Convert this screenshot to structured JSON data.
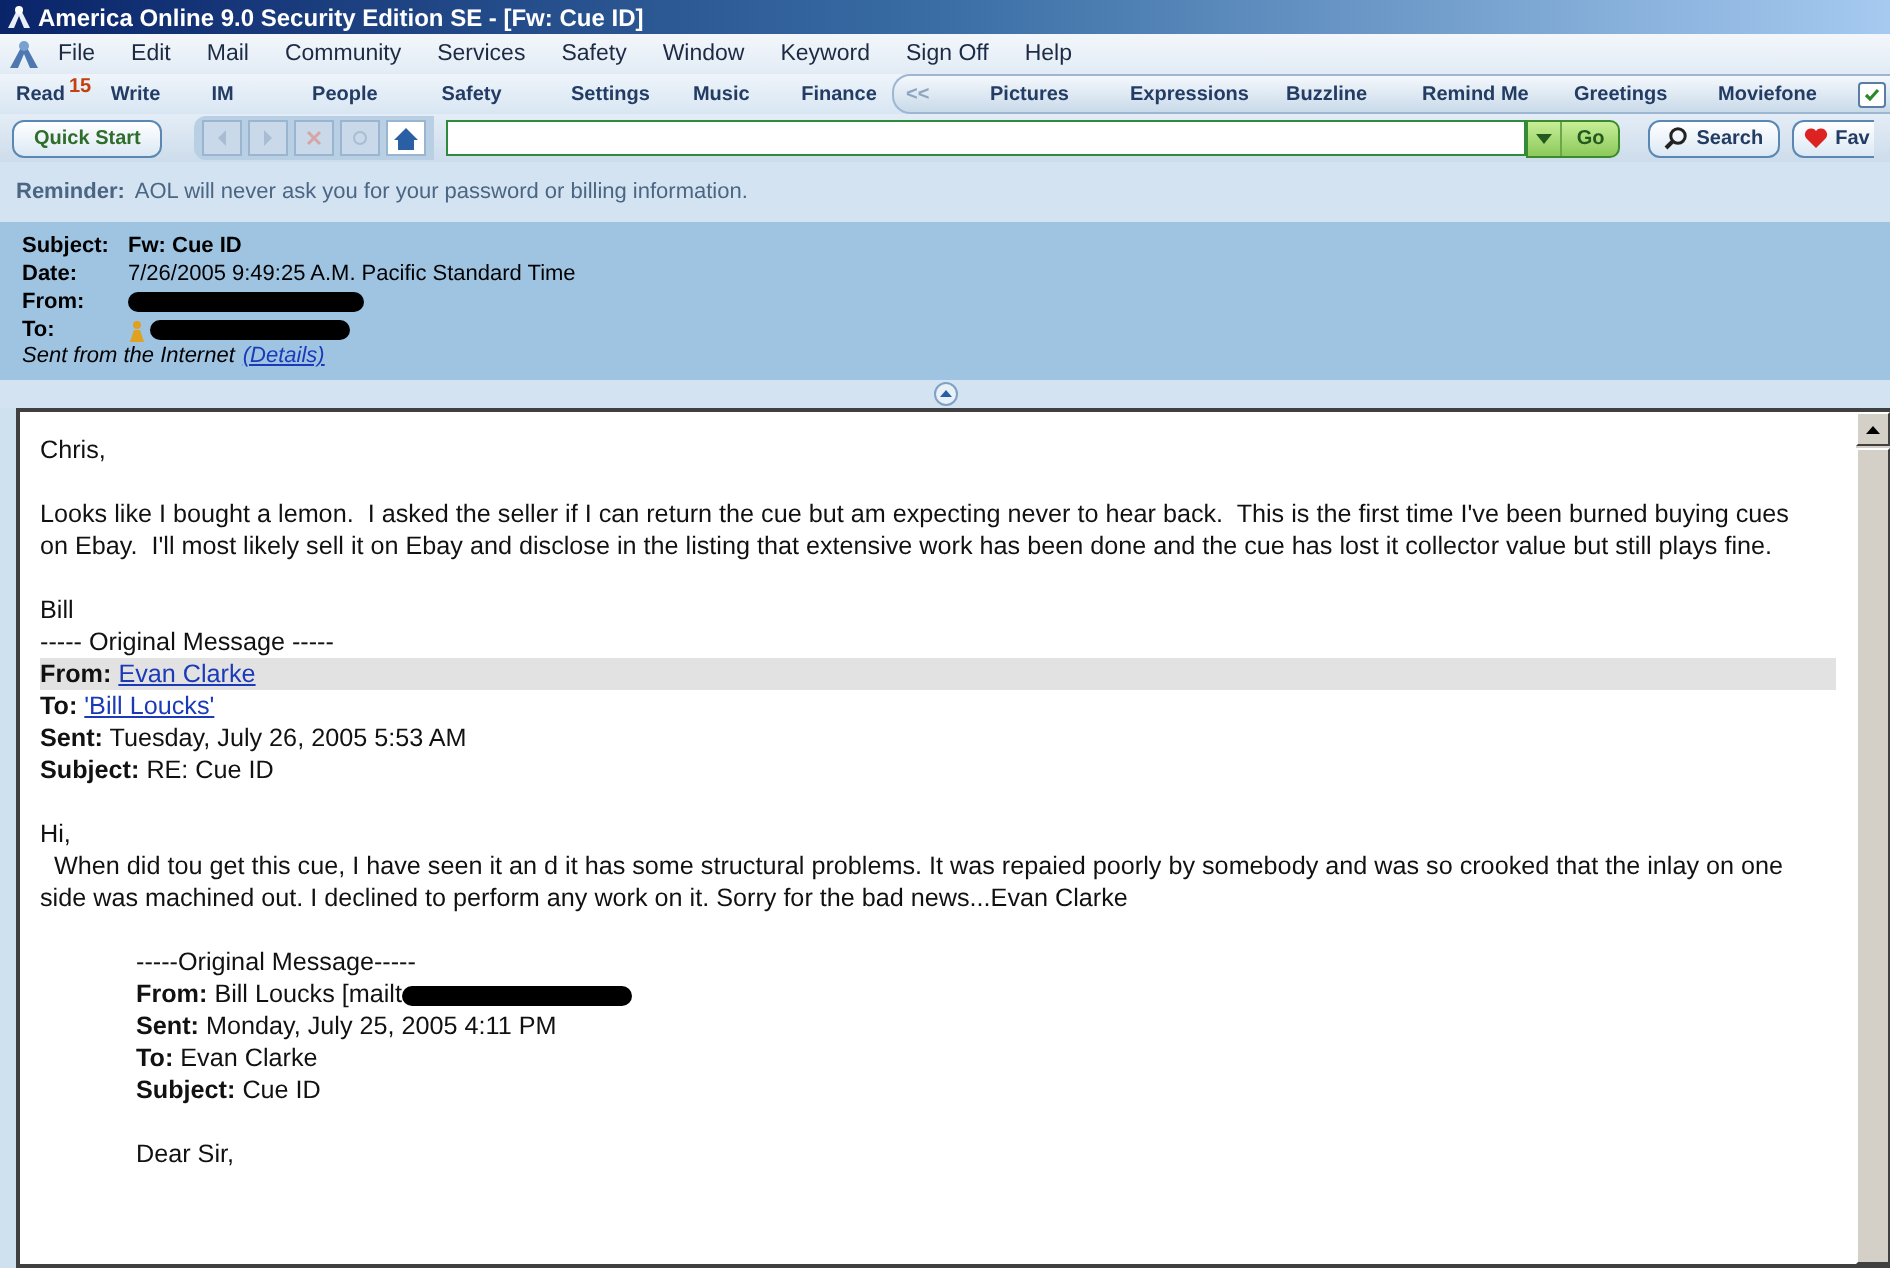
{
  "window": {
    "title": "America Online 9.0 Security Edition SE - [Fw: Cue ID]"
  },
  "menu": [
    "File",
    "Edit",
    "Mail",
    "Community",
    "Services",
    "Safety",
    "Window",
    "Keyword",
    "Sign Off",
    "Help"
  ],
  "toolbar": [
    {
      "label": "Read",
      "badge": "15"
    },
    {
      "label": "Write"
    },
    {
      "label": "IM"
    },
    {
      "label": "People"
    },
    {
      "label": "Safety"
    },
    {
      "label": "Settings"
    },
    {
      "label": "Music"
    },
    {
      "label": "Finance"
    }
  ],
  "toolbar_right": {
    "collapse": "<<",
    "items": [
      "Pictures",
      "Expressions",
      "Buzzline",
      "Remind Me",
      "Greetings",
      "Moviefone"
    ],
    "checked": true
  },
  "address_bar": {
    "quick_start": "Quick Start",
    "go": "Go",
    "search": "Search",
    "favorites": "Fav"
  },
  "reminder": {
    "label": "Reminder:",
    "text": "AOL will never ask you for your password or billing information."
  },
  "header": {
    "fields": [
      {
        "label": "Subject:",
        "value": "Fw: Cue ID",
        "bold": true,
        "redacted": false
      },
      {
        "label": "Date:",
        "value": "7/26/2005 9:49:25 A.M. Pacific Standard Time",
        "bold": false,
        "redacted": false
      },
      {
        "label": "From:",
        "redacted": true
      },
      {
        "label": "To:",
        "redacted": true
      }
    ],
    "source": "Sent from the Internet",
    "details": "(Details)"
  },
  "body": [
    {
      "kind": "para",
      "text": "Chris,"
    },
    {
      "kind": "gap"
    },
    {
      "kind": "para",
      "text": "Looks like I bought a lemon.  I asked the seller if I can return the cue but am expecting never to hear back.  This is the first time I've been burned buying cues on Ebay.  I'll most likely sell it on Ebay and disclose in the listing that extensive work has been done and the cue has lost it collector value but still plays fine."
    },
    {
      "kind": "gap"
    },
    {
      "kind": "para",
      "text": "Bill"
    },
    {
      "kind": "para",
      "text": "----- Original Message -----"
    },
    {
      "kind": "field",
      "label": "From:",
      "value": "Evan Clarke",
      "link": true,
      "highlight": true
    },
    {
      "kind": "field",
      "label": "To:",
      "value": "'Bill Loucks'",
      "link": true,
      "highlight": false
    },
    {
      "kind": "field",
      "label": "Sent:",
      "value": "Tuesday, July 26, 2005 5:53 AM",
      "link": false,
      "highlight": false
    },
    {
      "kind": "field",
      "label": "Subject:",
      "value": "RE: Cue ID",
      "link": false,
      "highlight": false
    },
    {
      "kind": "gap"
    },
    {
      "kind": "para",
      "text": "Hi,"
    },
    {
      "kind": "para",
      "text": "  When did tou get this cue, I have seen it an d it has some structural problems. It was repaied poorly by somebody and was so crooked that the inlay on one side was machined out. I declined to perform any work on it. Sorry for the bad news...Evan Clarke"
    },
    {
      "kind": "gap"
    },
    {
      "kind": "quote",
      "children": [
        {
          "kind": "para",
          "text": "-----Original Message-----"
        },
        {
          "kind": "field",
          "label": "From:",
          "value": "Bill Loucks [mailt",
          "link": false,
          "highlight": false,
          "redacted": true
        },
        {
          "kind": "field",
          "label": "Sent:",
          "value": "Monday, July 25, 2005 4:11 PM",
          "link": false,
          "highlight": false
        },
        {
          "kind": "field",
          "label": "To:",
          "value": "Evan Clarke",
          "link": false,
          "highlight": false
        },
        {
          "kind": "field",
          "label": "Subject:",
          "value": "Cue ID",
          "link": false,
          "highlight": false
        },
        {
          "kind": "gap"
        },
        {
          "kind": "para",
          "text": "Dear Sir,"
        }
      ]
    }
  ]
}
